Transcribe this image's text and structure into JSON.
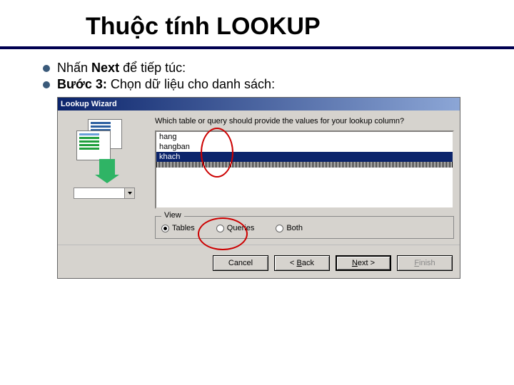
{
  "slide": {
    "title": "Thuộc tính LOOKUP",
    "bullet1_prefix": "Nhấn ",
    "bullet1_bold": "Next",
    "bullet1_suffix": " để tiếp túc:",
    "bullet2_bold": "Bước 3:",
    "bullet2_rest": " Chọn dữ liệu cho danh sách:"
  },
  "wizard": {
    "title": "Lookup Wizard",
    "prompt": "Which table or query should provide the values for your lookup column?",
    "list": {
      "items": [
        "hang",
        "hangban",
        "khach"
      ],
      "selected_index": 2
    },
    "view": {
      "legend": "View",
      "options": [
        "Tables",
        "Queries",
        "Both"
      ],
      "selected_index": 0
    },
    "buttons": {
      "cancel": "Cancel",
      "back_prefix": "< ",
      "back_ul": "B",
      "back_rest": "ack",
      "next_ul": "N",
      "next_rest": "ext >",
      "finish_ul": "F",
      "finish_rest": "inish"
    }
  }
}
